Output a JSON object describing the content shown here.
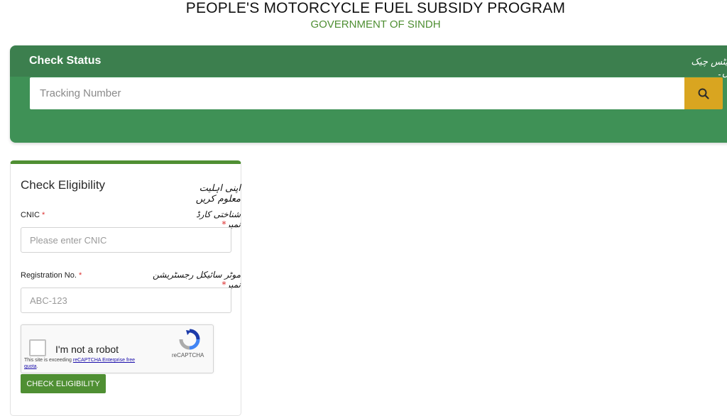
{
  "header": {
    "title": "PEOPLE'S MOTORCYCLE FUEL SUBSIDY PROGRAM",
    "subtitle": "GOVERNMENT OF SINDH"
  },
  "status": {
    "title": "Check Status",
    "title_urdu": "اسٹیٹس چیک کریں۔",
    "tracking_placeholder": "Tracking Number",
    "tracking_value": "",
    "search_icon": "search-icon"
  },
  "eligibility": {
    "title": "Check Eligibility",
    "title_urdu": "اپنی اہلیت معلوم کریں",
    "cnic": {
      "label": "CNIC",
      "required_mark": "*",
      "label_urdu": "شناختی کارڈ نمبر",
      "placeholder": "Please enter CNIC",
      "value": ""
    },
    "registration": {
      "label": "Registration No.",
      "required_mark": "*",
      "label_urdu": "موٹر سائیکل رجسٹریشن نمبر",
      "placeholder": "ABC-123",
      "value": ""
    },
    "recaptcha": {
      "label": "I'm not a robot",
      "warning_prefix": "This site is exceeding ",
      "warning_link": "reCAPTCHA Enterprise free quota",
      "warning_suffix": ".",
      "brand": "reCAPTCHA",
      "checked": false
    },
    "submit_label": "CHECK ELIGIBILITY"
  },
  "colors": {
    "brand_green": "#4f8f33",
    "panel_green": "#3f9156",
    "search_button": "#d9a520",
    "required": "#d33333"
  }
}
